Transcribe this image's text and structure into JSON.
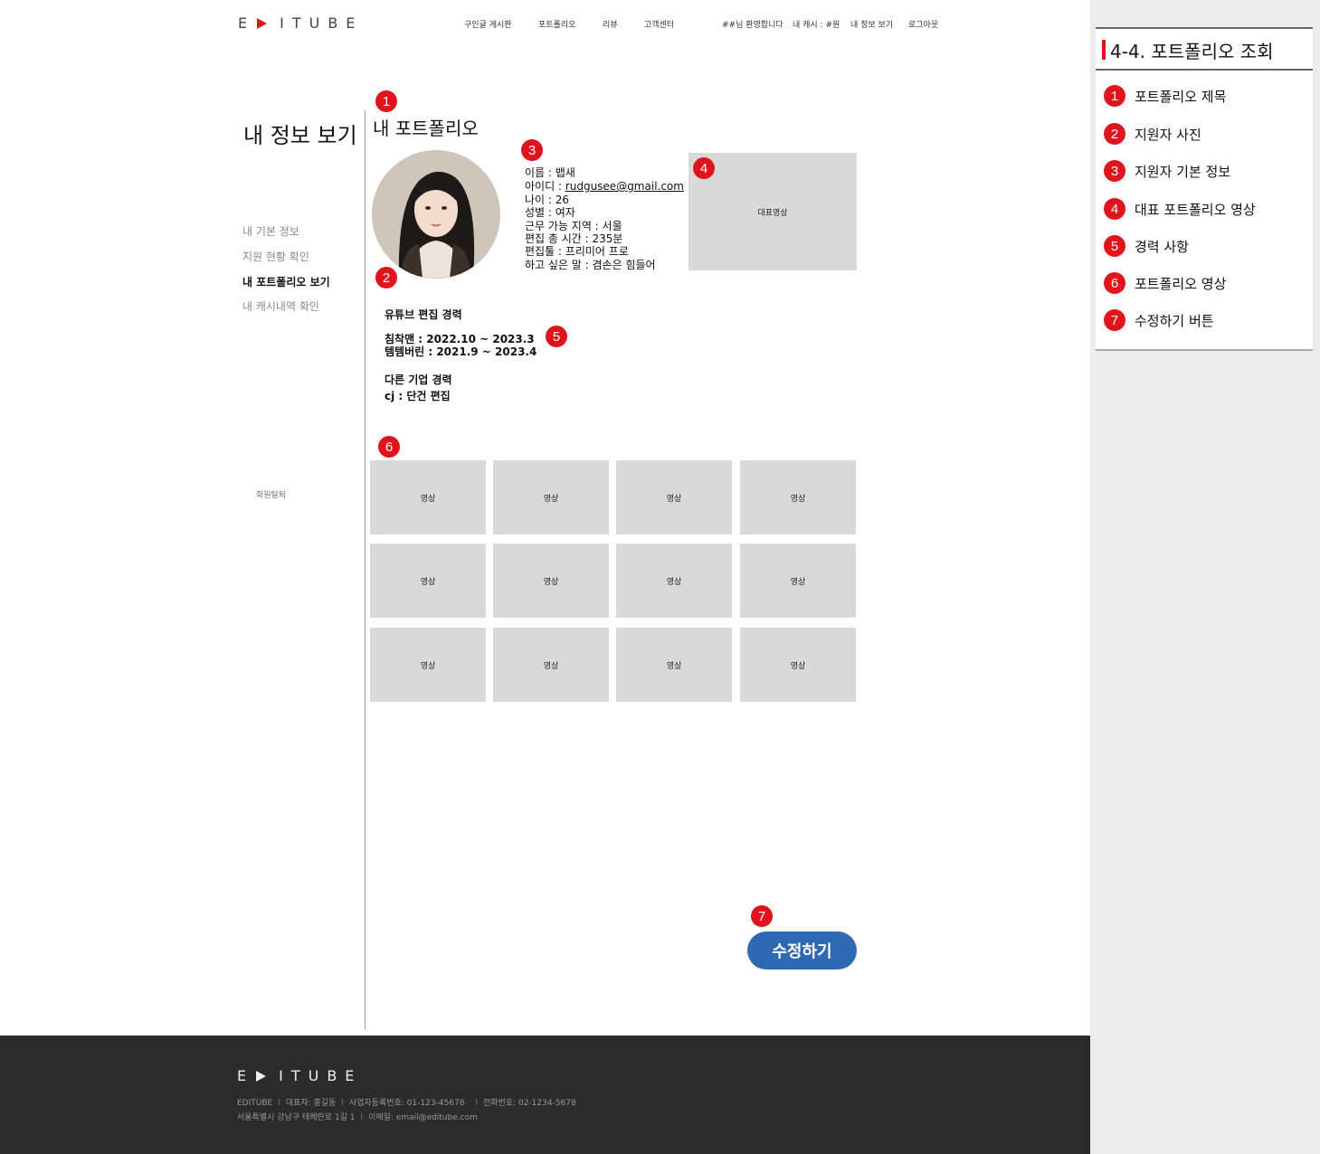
{
  "header": {
    "logo_left": "E",
    "logo_right": "ITUBE",
    "nav": [
      "구인글 게시판",
      "포트폴리오",
      "리뷰",
      "고객센터"
    ],
    "welcome": "##님 환영합니다",
    "cash": "내 캐시 : #원",
    "my_info": "내 정보 보기",
    "logout": "로그아웃"
  },
  "sidebar": {
    "title": "내 정보 보기",
    "items": [
      {
        "label": "내 기본 정보",
        "active": false
      },
      {
        "label": "지원 현황 확인",
        "active": false
      },
      {
        "label": "내 포트폴리오 보기",
        "active": true
      },
      {
        "label": "내 캐시내역 확인",
        "active": false
      }
    ],
    "withdraw": "회원탈퇴"
  },
  "main": {
    "title": "내 포트폴리오",
    "info": {
      "name": "이름 : 뱁새",
      "id_label": "아이디 : ",
      "id_value": "rudgusee@gmail.com",
      "age": "나이 : 26",
      "gender": "성별 : 여자",
      "region": "근무 가능 지역  : 서울",
      "total_time": "편집 총 시간  : 235분",
      "tool": "편집툴  : 프리미어 프로",
      "message": "하고 싶은 말  : 겸손은 힘들어"
    },
    "rep_video": "대표영상",
    "career": {
      "youtube_title": "유튜브 편집 경력",
      "youtube_1": "침착맨 : 2022.10 ~ 2023.3",
      "youtube_2": "템템버린 : 2021.9 ~ 2023.4",
      "other_title": "다른 기업 경력",
      "other_1": "cj : 단건 편집"
    },
    "video_label": "영상",
    "edit_button": "수정하기"
  },
  "markers": [
    "1",
    "2",
    "3",
    "4",
    "5",
    "6",
    "7"
  ],
  "footer": {
    "logo_left": "E",
    "logo_right": "ITUBE",
    "company": "EDITUBE",
    "ceo": "대표자: 홍길동",
    "biz_no": "사업자등록번호: 01-123-45678",
    "tel": "전화번호: 02-1234-5678",
    "address": "서울특별시 강남구 테헤란로 1길 1",
    "email": "이메일: email@editube.com",
    "sep": "l"
  },
  "panel": {
    "title": "4-4. 포트폴리오 조회",
    "items": [
      {
        "num": "1",
        "label": "포트폴리오 제목"
      },
      {
        "num": "2",
        "label": "지원자 사진"
      },
      {
        "num": "3",
        "label": "지원자 기본 정보"
      },
      {
        "num": "4",
        "label": "대표 포트폴리오 영상"
      },
      {
        "num": "5",
        "label": "경력 사항"
      },
      {
        "num": "6",
        "label": "포트폴리오 영상"
      },
      {
        "num": "7",
        "label": "수정하기 버튼"
      }
    ]
  },
  "colors": {
    "accent": "#e0141c",
    "button": "#2f69b3",
    "placeholder": "#d9d9d9",
    "footer_bg": "#2b2b2b",
    "panel_bg": "#ececec"
  }
}
